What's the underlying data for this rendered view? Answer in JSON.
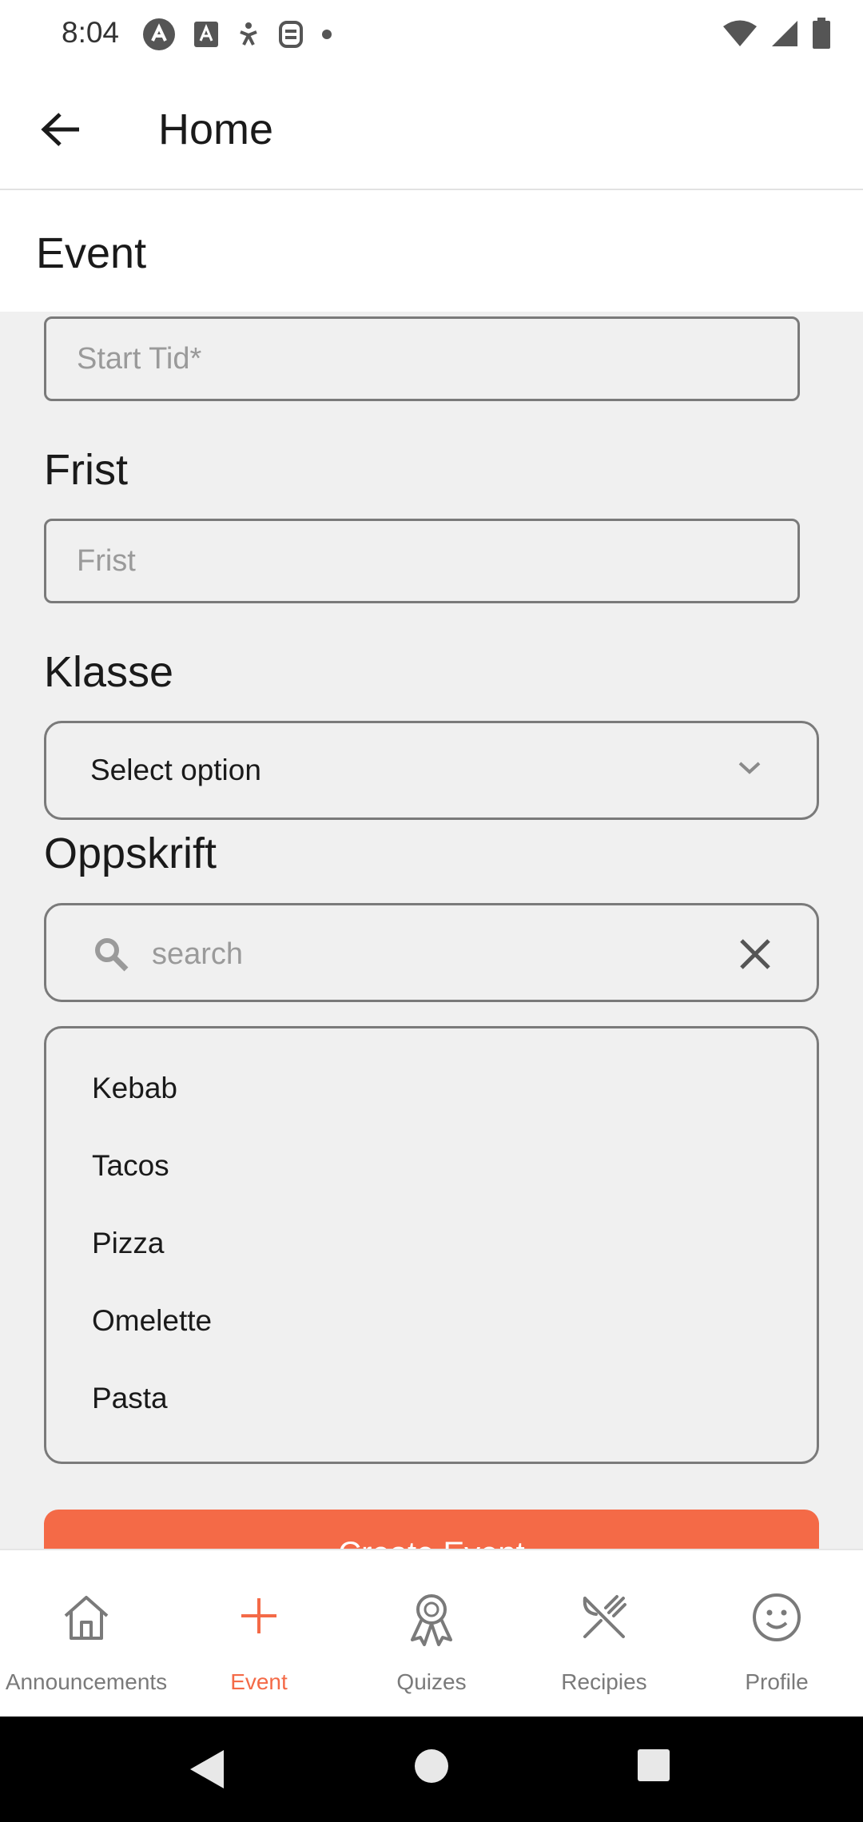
{
  "status_bar": {
    "time": "8:04",
    "left_icons": [
      "autopilot-icon",
      "keyboard-icon",
      "accessibility-icon",
      "face-icon",
      "dot-icon"
    ],
    "right_icons": [
      "wifi-icon",
      "signal-icon",
      "battery-icon"
    ]
  },
  "app_bar": {
    "title": "Home",
    "back_icon": "arrow-back-icon"
  },
  "section": {
    "title": "Event"
  },
  "form": {
    "start_time_placeholder": "Start Tid*",
    "deadline_label": "Frist",
    "deadline_placeholder": "Frist",
    "class_label": "Klasse",
    "class_select_value": "Select option",
    "recipe_label": "Oppskrift",
    "recipe_search_placeholder": "search",
    "recipe_options": [
      "Kebab",
      "Tacos",
      "Pizza",
      "Omelette",
      "Pasta"
    ],
    "create_button_label": "Create Event"
  },
  "bottom_nav": {
    "items": [
      {
        "label": "Announcements",
        "icon": "home-icon"
      },
      {
        "label": "Event",
        "icon": "plus-icon"
      },
      {
        "label": "Quizes",
        "icon": "award-icon"
      },
      {
        "label": "Recipies",
        "icon": "utensils-icon"
      },
      {
        "label": "Profile",
        "icon": "smiley-icon"
      }
    ],
    "active_index": 1
  },
  "colors": {
    "accent": "#f46a47",
    "border": "#7a7a7a",
    "background": "#f0f0f0"
  }
}
